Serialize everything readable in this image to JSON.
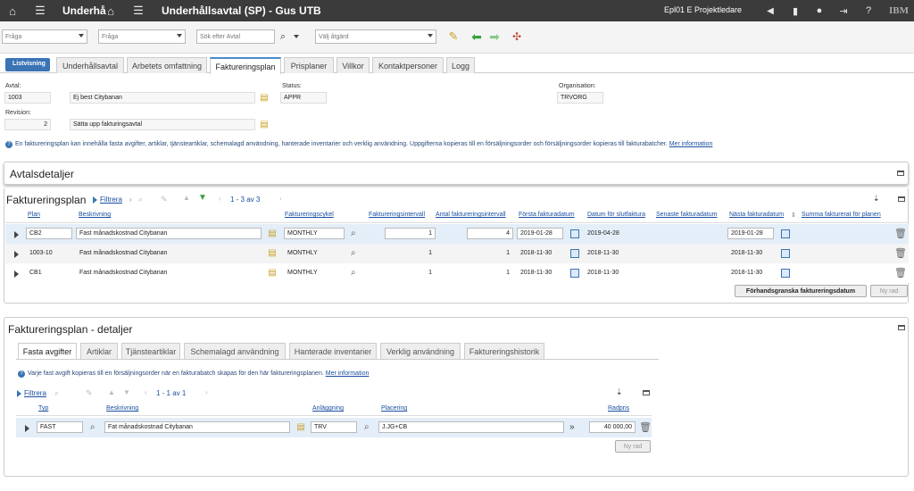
{
  "topbar": {
    "app_title_short": "Underhå",
    "page_title": "Underhållsavtal (SP) - Gus UTB",
    "user": "Epl01 E Projektledare",
    "brand": "IBM"
  },
  "toolbar": {
    "query1_placeholder": "Fråga",
    "query2_placeholder": "Fråga",
    "search_placeholder": "Sök efter Avtal",
    "action_placeholder": "Välj åtgärd"
  },
  "tabs": {
    "list": "Listvisning",
    "items": [
      "Underhållsavtal",
      "Arbetets omfattning",
      "Faktureringsplan",
      "Prisplaner",
      "Villkor",
      "Kontaktpersoner",
      "Logg"
    ]
  },
  "header": {
    "avtal_label": "Avtal:",
    "avtal_value": "1003",
    "avtal_desc": "Ej best Citybanan",
    "revision_label": "Revision:",
    "revision_value": "2",
    "revision_desc": "Sätta upp fakturingsavtal",
    "status_label": "Status:",
    "status_value": "APPR",
    "org_label": "Organisation:",
    "org_value": "TRVORG",
    "info_text": "En faktureringsplan kan innehålla fasta avgifter, artiklar, tjänsteartiklar, schemalagd användning, hanterade inventarier och verklig användning. Uppgifterna kopieras till en försäljningsorder och försäljningsorder kopieras till fakturabatcher.",
    "info_link": "Mer information"
  },
  "avtalsdetaljer": {
    "title": "Avtalsdetaljer"
  },
  "plan": {
    "title": "Faktureringsplan",
    "filter": "Filtrera",
    "pager": "1 - 3 av 3",
    "columns": [
      "Plan",
      "Beskrivning",
      "Faktureringscykel",
      "Faktureringsintervall",
      "Antal faktureringsintervall",
      "Första fakturadatum",
      "Datum för slutfaktura",
      "Senaste fakturadatum",
      "Nästa fakturadatum",
      "Summa fakturerat för planen"
    ],
    "rows": [
      {
        "plan": "CB2",
        "desc": "Fast månadskostnad Citybanan",
        "cycle": "MONTHLY",
        "interval": "1",
        "count": "4",
        "first": "2019-01-28",
        "end": "2019-04-28",
        "last": "",
        "next": "2019-01-28"
      },
      {
        "plan": "1003-10",
        "desc": "Fast månadskostnad Citybanan",
        "cycle": "MONTHLY",
        "interval": "1",
        "count": "1",
        "first": "2018-11-30",
        "end": "2018-11-30",
        "last": "",
        "next": "2018-11-30"
      },
      {
        "plan": "CB1",
        "desc": "Fast månadskostnad Citybanan",
        "cycle": "MONTHLY",
        "interval": "1",
        "count": "1",
        "first": "2018-11-30",
        "end": "2018-11-30",
        "last": "",
        "next": "2018-11-30"
      }
    ],
    "preview_button": "Förhandsgranska faktureringsdatum",
    "new_row_button": "Ny rad"
  },
  "details": {
    "title": "Faktureringsplan - detaljer",
    "tabs": [
      "Fasta avgifter",
      "Artiklar",
      "Tjänsteartiklar",
      "Schemalagd användning",
      "Hanterade inventarier",
      "Verklig användning",
      "Faktureringshistorik"
    ],
    "info_text": "Varje fast avgift kopieras till en försäljningsorder när en fakturabatch skapas för den här faktureringsplanen.",
    "info_link": "Mer information",
    "filter": "Filtrera",
    "pager": "1 - 1 av 1",
    "columns": [
      "Typ",
      "Beskrivning",
      "Anläggning",
      "Placering",
      "Radpris"
    ],
    "row": {
      "typ": "FAST",
      "desc": "Fat månadskostnad Citybanan",
      "anl": "TRV",
      "plac": "J.JG+CB",
      "price": "40 000,00"
    },
    "new_row_button": "Ny rad"
  }
}
